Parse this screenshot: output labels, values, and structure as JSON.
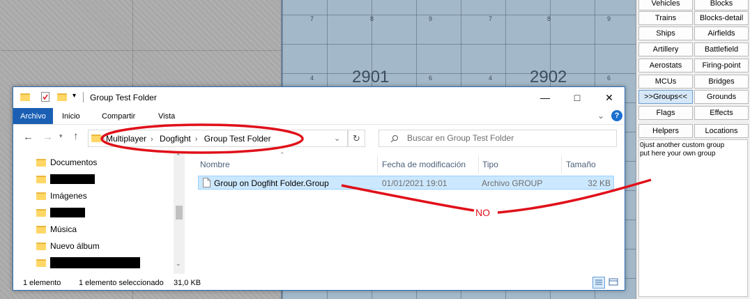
{
  "map": {
    "small_numbers": [
      "7",
      "8",
      "9",
      "7",
      "8",
      "9",
      "4",
      "6",
      "4",
      "6"
    ],
    "big_numbers": [
      "2901",
      "2902"
    ]
  },
  "panel": {
    "buttons": [
      {
        "label": "Vehicles"
      },
      {
        "label": "Blocks"
      },
      {
        "label": "Trains"
      },
      {
        "label": "Blocks-detail"
      },
      {
        "label": "Ships"
      },
      {
        "label": "Airfields"
      },
      {
        "label": "Artillery"
      },
      {
        "label": "Battlefield"
      },
      {
        "label": "Aerostats"
      },
      {
        "label": "Firing-point"
      },
      {
        "label": "MCUs"
      },
      {
        "label": "Bridges"
      },
      {
        "label": ">>Groups<<"
      },
      {
        "label": "Grounds"
      },
      {
        "label": "Flags"
      },
      {
        "label": "Effects"
      },
      {
        "label": "Helpers"
      },
      {
        "label": "Locations"
      }
    ],
    "description_line1": "0just another custom group",
    "description_line2": "put here your own group"
  },
  "window": {
    "title": "Group Test Folder",
    "ribbon_tabs": [
      "Archivo",
      "Inicio",
      "Compartir",
      "Vista"
    ],
    "address": {
      "crumbs": [
        "Multiplayer",
        "Dogfight",
        "Group Test Folder"
      ]
    },
    "search": {
      "placeholder": "Buscar en Group Test Folder"
    },
    "nav_items": [
      {
        "label": "Documentos"
      },
      {
        "label": ""
      },
      {
        "label": "Imágenes"
      },
      {
        "label": ""
      },
      {
        "label": "Música"
      },
      {
        "label": "Nuevo álbum"
      },
      {
        "label": ""
      }
    ],
    "columns": {
      "name": "Nombre",
      "date": "Fecha de modificación",
      "type": "Tipo",
      "size": "Tamaño"
    },
    "files": [
      {
        "name": "Group on Dogfiht Folder.Group",
        "date": "01/01/2021 19:01",
        "type": "Archivo GROUP",
        "size": "32 KB"
      }
    ],
    "status": {
      "count": "1 elemento",
      "selected": "1 elemento seleccionado",
      "size": "31,0 KB"
    }
  },
  "annotation": {
    "label": "NO",
    "color": "#e0101a"
  },
  "colors": {
    "accent": "#1a5fb4",
    "selection": "#cce8ff",
    "folder": "#ffd766"
  }
}
